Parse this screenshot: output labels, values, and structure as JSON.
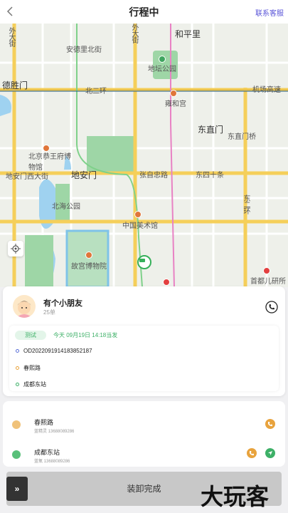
{
  "header": {
    "title": "行程中",
    "contact": "联系客服"
  },
  "map": {
    "labels": {
      "hepingli": "和平里",
      "anding": "安德里北街",
      "ditan": "地坛公园",
      "deshengmen": "德胜门",
      "beierhuan": "北二环",
      "airport": "机场高速",
      "yonghegong": "雍和宫",
      "dongzhimen": "东直门",
      "dongzhimenqiao": "东直门桥",
      "gongwangfu": "北京恭王府博物馆",
      "dianmen": "地安门西大街",
      "dianmen2": "地安门",
      "zhangzizhong": "张自忠路",
      "dongsi": "东四十条",
      "beihai": "北海公园",
      "meishuguan": "中国美术馆",
      "gugong": "故宫博物院",
      "dongerhuan": "东二环",
      "shoudu": "首都儿研所",
      "andingmen": "外大街",
      "andingmen2": "外大街"
    }
  },
  "order": {
    "name": "有个小朋友",
    "orders": "25单",
    "badge": "测试",
    "time": "今天 09月19日 14:18当发",
    "order_no": "OD2022091914183852187",
    "start": "春熙路",
    "end": "成都东站"
  },
  "waypoints": [
    {
      "name": "春熙路",
      "sub": "蓝精灵  13688089286"
    },
    {
      "name": "成都东站",
      "sub": "蓝氧  13688089286"
    }
  ],
  "bottom": {
    "slider": "»",
    "done": "装卸完成",
    "watermark": "大玩客"
  },
  "colors": {
    "accent": "#5a55d8",
    "green": "#3db067",
    "orange": "#e8a33d"
  }
}
